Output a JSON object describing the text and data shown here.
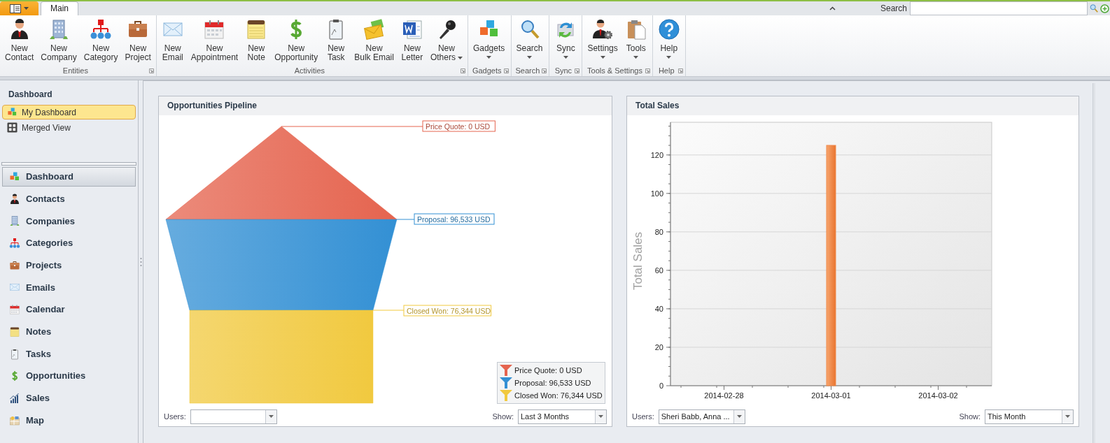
{
  "ribbon": {
    "tabs": [
      {
        "label": "Main",
        "selected": true
      }
    ],
    "search": {
      "label": "Search"
    },
    "groups": [
      {
        "label": "Entities",
        "buttons": [
          {
            "lines": [
              "New",
              "Contact"
            ]
          },
          {
            "lines": [
              "New",
              "Company"
            ]
          },
          {
            "lines": [
              "New",
              "Category"
            ]
          },
          {
            "lines": [
              "New",
              "Project"
            ]
          }
        ]
      },
      {
        "label": "Activities",
        "buttons": [
          {
            "lines": [
              "New",
              "Email"
            ]
          },
          {
            "lines": [
              "New",
              "Appointment"
            ]
          },
          {
            "lines": [
              "New",
              "Note"
            ]
          },
          {
            "lines": [
              "New",
              "Opportunity"
            ]
          },
          {
            "lines": [
              "New",
              "Task"
            ]
          },
          {
            "lines": [
              "New",
              "Bulk Email"
            ]
          },
          {
            "lines": [
              "New",
              "Letter"
            ]
          },
          {
            "lines": [
              "New",
              "Others"
            ],
            "dropdown": true
          }
        ]
      },
      {
        "label": "Gadgets",
        "buttons": [
          {
            "lines": [
              "Gadgets"
            ],
            "dropdown": true
          }
        ]
      },
      {
        "label": "Search",
        "buttons": [
          {
            "lines": [
              "Search"
            ],
            "dropdown": true
          }
        ]
      },
      {
        "label": "Sync",
        "buttons": [
          {
            "lines": [
              "Sync"
            ],
            "dropdown": true
          }
        ]
      },
      {
        "label": "Tools & Settings",
        "buttons": [
          {
            "lines": [
              "Settings"
            ],
            "dropdown": true
          },
          {
            "lines": [
              "Tools"
            ],
            "dropdown": true
          }
        ]
      },
      {
        "label": "Help",
        "buttons": [
          {
            "lines": [
              "Help"
            ],
            "dropdown": true
          }
        ]
      }
    ]
  },
  "sidebar": {
    "header": "Dashboard",
    "views": [
      {
        "label": "My Dashboard",
        "selected": true
      },
      {
        "label": "Merged View",
        "selected": false
      }
    ],
    "nav": [
      {
        "label": "Dashboard",
        "selected": true
      },
      {
        "label": "Contacts",
        "selected": false
      },
      {
        "label": "Companies",
        "selected": false
      },
      {
        "label": "Categories",
        "selected": false
      },
      {
        "label": "Projects",
        "selected": false
      },
      {
        "label": "Emails",
        "selected": false
      },
      {
        "label": "Calendar",
        "selected": false
      },
      {
        "label": "Notes",
        "selected": false
      },
      {
        "label": "Tasks",
        "selected": false
      },
      {
        "label": "Opportunities",
        "selected": false
      },
      {
        "label": "Sales",
        "selected": false
      },
      {
        "label": "Map",
        "selected": false
      }
    ]
  },
  "pipeline": {
    "title": "Opportunities Pipeline",
    "stages": [
      {
        "label": "Price Quote: 0 USD",
        "color": "#e5644f"
      },
      {
        "label": "Proposal: 96,533 USD",
        "color": "#3390d4"
      },
      {
        "label": "Closed Won: 76,344 USD",
        "color": "#f1c93f"
      }
    ],
    "legend": [
      {
        "label": "Price Quote: 0 USD",
        "color": "#e5644f"
      },
      {
        "label": "Proposal: 96,533 USD",
        "color": "#3390d4"
      },
      {
        "label": "Closed Won: 76,344 USD",
        "color": "#f1c93f"
      }
    ],
    "users": {
      "label": "Users:"
    },
    "show": {
      "label": "Show:",
      "value": "Last 3 Months"
    }
  },
  "sales": {
    "title": "Total Sales",
    "chart_data": {
      "type": "bar",
      "ylabel": "Total Sales",
      "categories": [
        "2014-02-28",
        "2014-03-01",
        "2014-03-02"
      ],
      "series": [
        {
          "color": "#f08a4b",
          "values": [
            0,
            125,
            0
          ]
        }
      ],
      "ylim": [
        0,
        137
      ],
      "yticks": [
        0,
        20,
        40,
        60,
        80,
        100,
        120
      ],
      "grid": true
    },
    "users": {
      "label": "Users:",
      "value": "Sheri Babb, Anna ..."
    },
    "show": {
      "label": "Show:",
      "value": "This Month"
    }
  }
}
